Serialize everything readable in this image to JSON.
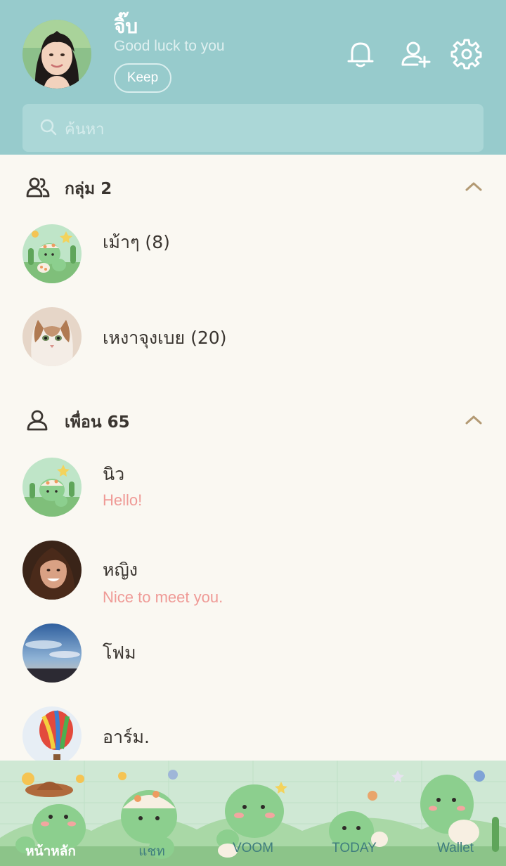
{
  "profile": {
    "name": "จิ๊บ",
    "status": "Good luck to you",
    "keep_label": "Keep"
  },
  "header_icons": [
    "bell-icon",
    "add-friend-icon",
    "gear-icon"
  ],
  "search": {
    "placeholder": "ค้นหา"
  },
  "groups": {
    "title": "กลุ่ม 2",
    "items": [
      {
        "name": "เม้าๆ (8)"
      },
      {
        "name": "เหงาจุงเบย (20)"
      }
    ]
  },
  "friends": {
    "title": "เพื่อน 65",
    "items": [
      {
        "name": "นิว",
        "message": "Hello!"
      },
      {
        "name": "หญิง",
        "message": "Nice to meet you."
      },
      {
        "name": "โฟม",
        "message": ""
      },
      {
        "name": "อาร์ม.",
        "message": ""
      }
    ]
  },
  "nav": {
    "items": [
      {
        "label": "หน้าหลัก",
        "active": true
      },
      {
        "label": "แชท"
      },
      {
        "label": "VOOM"
      },
      {
        "label": "TODAY"
      },
      {
        "label": "Wallet"
      }
    ]
  },
  "colors": {
    "header_bg": "#97cbcc",
    "body_bg": "#faf8f2",
    "message_text": "#ef9a96",
    "chevron": "#b39a74"
  }
}
